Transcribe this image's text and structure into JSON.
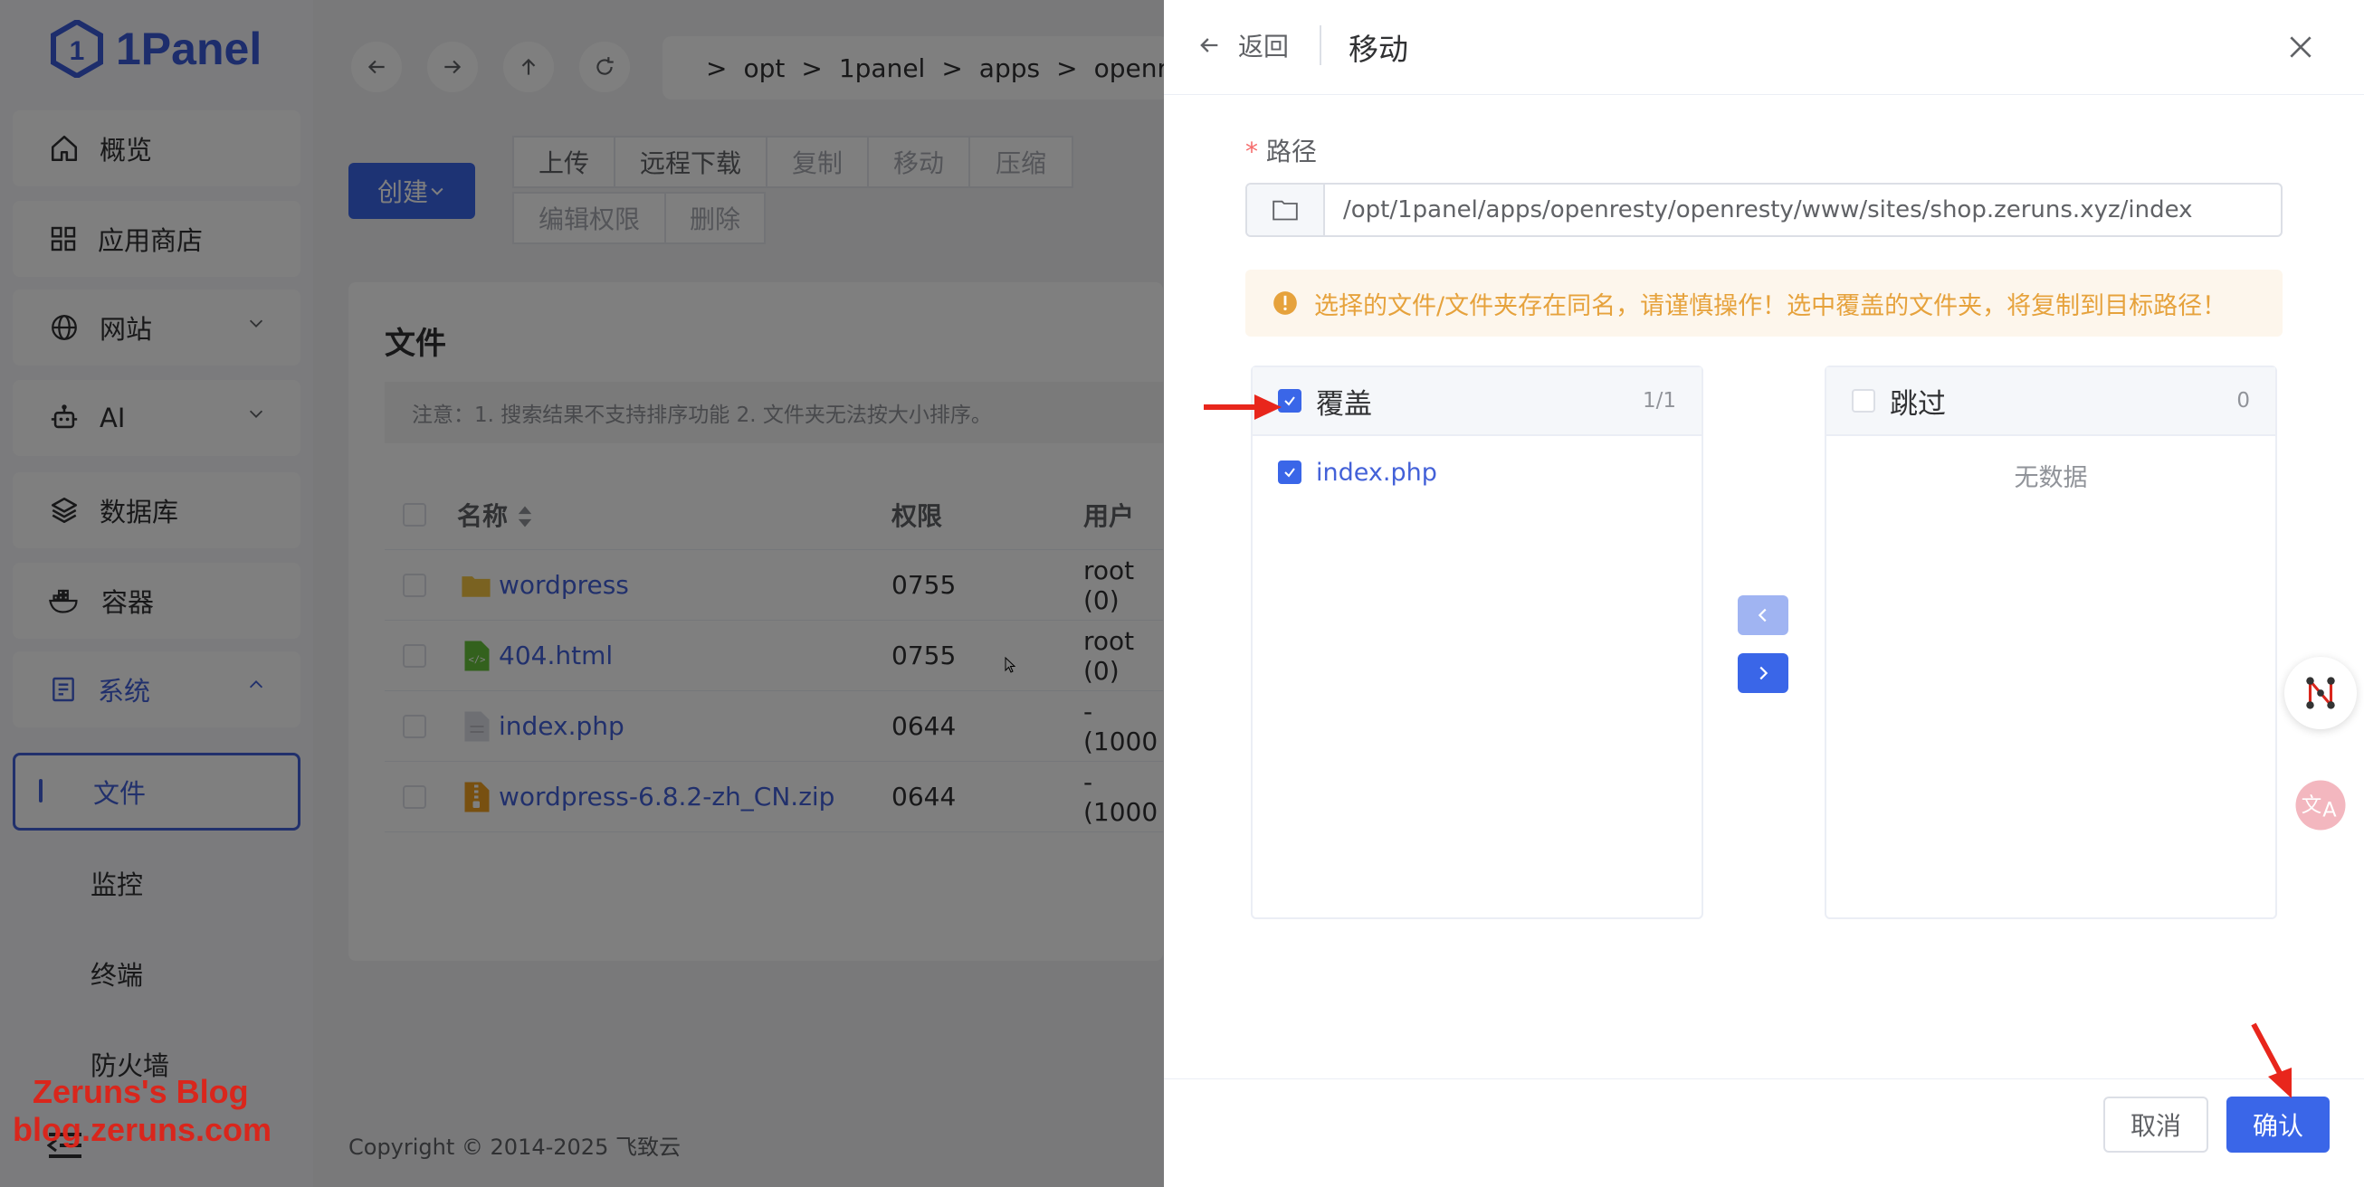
{
  "app": {
    "logo_text": "1Panel"
  },
  "sidebar": {
    "items": [
      {
        "label": "概览",
        "icon": "home-icon"
      },
      {
        "label": "应用商店",
        "icon": "grid-icon"
      },
      {
        "label": "网站",
        "icon": "globe-icon"
      },
      {
        "label": "AI",
        "icon": "robot-icon"
      },
      {
        "label": "数据库",
        "icon": "layers-icon"
      },
      {
        "label": "容器",
        "icon": "docker-icon"
      },
      {
        "label": "系统",
        "icon": "server-icon"
      }
    ],
    "sub_items": [
      {
        "label": "文件",
        "active": true
      },
      {
        "label": "监控"
      },
      {
        "label": "终端"
      },
      {
        "label": "防火墙"
      }
    ]
  },
  "breadcrumb": [
    "opt",
    "1panel",
    "apps",
    "openresty"
  ],
  "toolbar": {
    "create_label": "创建",
    "buttons": [
      "上传",
      "远程下载",
      "复制",
      "移动",
      "压缩",
      "编辑权限",
      "删除"
    ]
  },
  "files": {
    "title": "文件",
    "notice": "注意：1. 搜索结果不支持排序功能 2. 文件夹无法按大小排序。",
    "columns": [
      "名称",
      "权限",
      "用户"
    ],
    "rows": [
      {
        "name": "wordpress",
        "perm": "0755",
        "user": "root (0)",
        "type": "folder"
      },
      {
        "name": "404.html",
        "perm": "0755",
        "user": "root (0)",
        "type": "html"
      },
      {
        "name": "index.php",
        "perm": "0644",
        "user": "- (1000",
        "type": "file"
      },
      {
        "name": "wordpress-6.8.2-zh_CN.zip",
        "perm": "0644",
        "user": "- (1000",
        "type": "zip"
      }
    ]
  },
  "footer": {
    "copyright": "Copyright © 2014-2025 飞致云"
  },
  "watermark": {
    "line1": "Zeruns's Blog",
    "line2": "blog.zeruns.com"
  },
  "drawer": {
    "back_label": "返回",
    "title": "移动",
    "path_label": "路径",
    "required_mark": "*",
    "path_value": "/opt/1panel/apps/openresty/openresty/www/sites/shop.zeruns.xyz/index",
    "warning": "选择的文件/文件夹存在同名，请谨慎操作！选中覆盖的文件夹，将复制到目标路径！",
    "left_panel": {
      "title": "覆盖",
      "count": "1/1",
      "items": [
        "index.php"
      ]
    },
    "right_panel": {
      "title": "跳过",
      "count": "0",
      "empty": "无数据"
    },
    "cancel_label": "取消",
    "confirm_label": "确认"
  },
  "colors": {
    "primary": "#3a66e8",
    "warning_bg": "#fdf6ec",
    "warning_text": "#e6a23c",
    "annotation_red": "#e8261c"
  }
}
